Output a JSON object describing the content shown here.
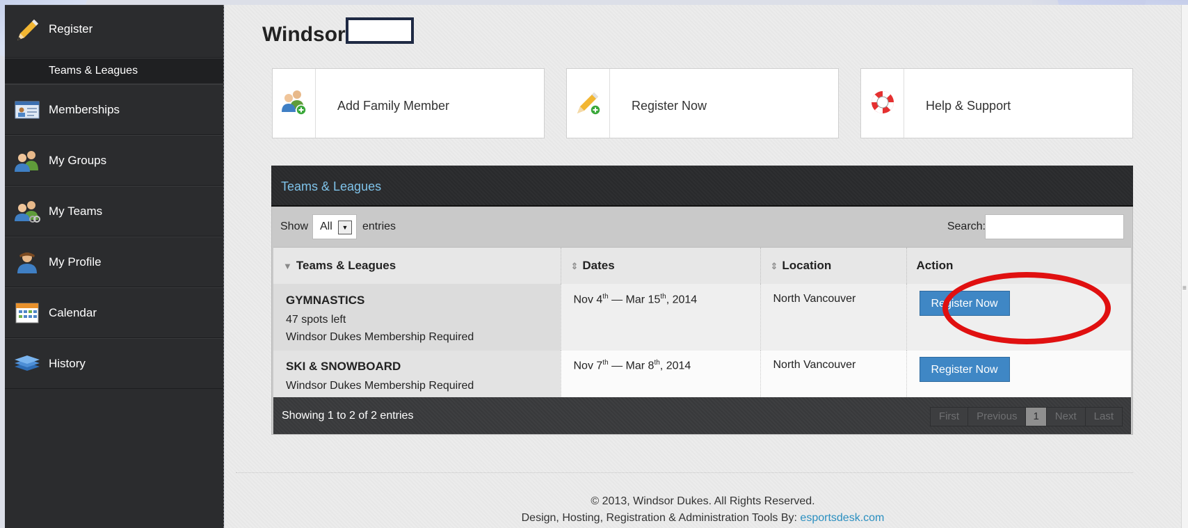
{
  "sidebar": {
    "items": [
      {
        "label": "Register",
        "icon": "pencil-icon"
      },
      {
        "label": "Teams & Leagues"
      },
      {
        "label": "Memberships",
        "icon": "id-card-icon"
      },
      {
        "label": "My Groups",
        "icon": "group-icon"
      },
      {
        "label": "My Teams",
        "icon": "team-icon"
      },
      {
        "label": "My Profile",
        "icon": "user-icon"
      },
      {
        "label": "Calendar",
        "icon": "calendar-icon"
      },
      {
        "label": "History",
        "icon": "layers-icon"
      }
    ]
  },
  "header": {
    "title": "Windsor"
  },
  "quick_actions": [
    {
      "label": "Add Family Member",
      "icon": "add-user-icon"
    },
    {
      "label": "Register Now",
      "icon": "pencil-add-icon"
    },
    {
      "label": "Help & Support",
      "icon": "lifebuoy-icon"
    }
  ],
  "panel": {
    "title": "Teams & Leagues",
    "show_label": "Show",
    "show_value": "All",
    "entries_label": "entries",
    "search_label": "Search:",
    "search_value": "",
    "columns": [
      "Teams & Leagues",
      "Dates",
      "Location",
      "Action"
    ],
    "rows": [
      {
        "name": "GYMNASTICS",
        "spots": "47 spots left",
        "requirement": "Windsor Dukes Membership Required",
        "date_start_month": "Nov 4",
        "date_start_sup": "th",
        "date_sep": "—",
        "date_end_month": "Mar 15",
        "date_end_sup": "th",
        "date_year": ", 2014",
        "location": "North Vancouver",
        "action": "Register Now"
      },
      {
        "name": "SKI & SNOWBOARD",
        "requirement": "Windsor Dukes Membership Required",
        "date_start_month": "Nov 7",
        "date_start_sup": "th",
        "date_sep": "—",
        "date_end_month": "Mar 8",
        "date_end_sup": "th",
        "date_year": ", 2014",
        "location": "North Vancouver",
        "action": "Register Now"
      }
    ],
    "showing": "Showing 1 to 2 of 2 entries",
    "pager": {
      "first": "First",
      "previous": "Previous",
      "current": "1",
      "next": "Next",
      "last": "Last"
    }
  },
  "footer": {
    "copyright": "© 2013, Windsor Dukes. All Rights Reserved.",
    "credit": "Design, Hosting, Registration & Administration Tools By:",
    "credit_link": "esportsdesk.com"
  },
  "colors": {
    "sidebar_bg": "#2b2c2e",
    "panel_title": "#7fc3ea",
    "button_blue": "#3f87c5",
    "annotation_red": "#e01010",
    "link": "#2a8fc0"
  }
}
